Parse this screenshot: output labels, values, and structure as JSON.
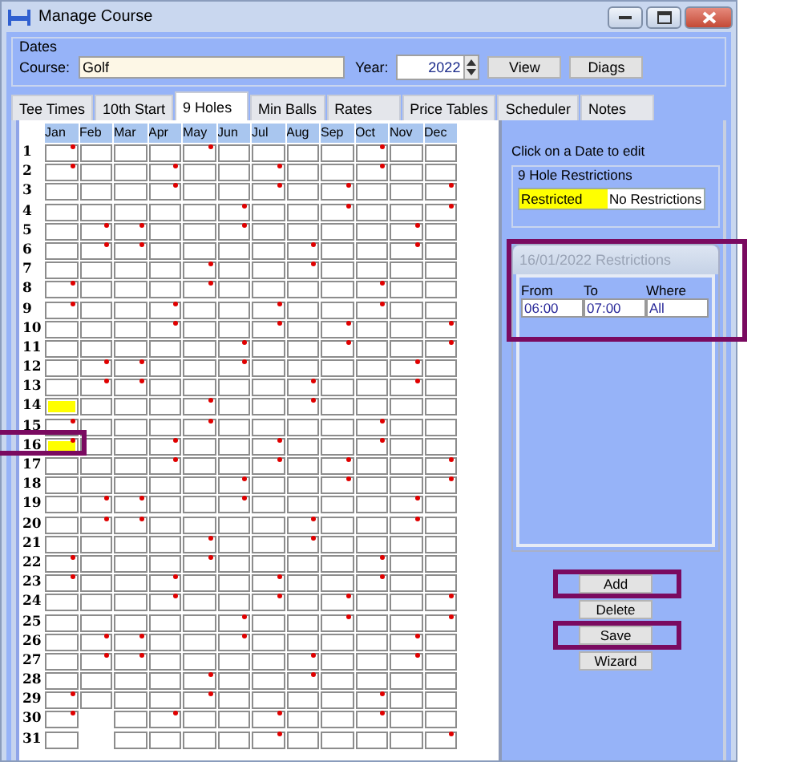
{
  "window": {
    "title": "Manage Course"
  },
  "dates": {
    "legend": "Dates",
    "course_label": "Course:",
    "course": "Golf",
    "year_label": "Year:",
    "year": "2022",
    "buttons": [
      "View",
      "Diags"
    ]
  },
  "tabs": [
    {
      "label": "Tee Times",
      "selected": false
    },
    {
      "label": "10th Start",
      "selected": false
    },
    {
      "label": "9 Holes",
      "selected": true
    },
    {
      "label": "Min Balls",
      "selected": false
    },
    {
      "label": "Rates",
      "selected": false
    },
    {
      "label": "Price Tables",
      "selected": false
    },
    {
      "label": "Scheduler",
      "selected": false
    },
    {
      "label": "Notes",
      "selected": false
    }
  ],
  "calendar": {
    "months": [
      "Jan",
      "Feb",
      "Mar",
      "Apr",
      "May",
      "Jun",
      "Jul",
      "Aug",
      "Sep",
      "Oct",
      "Nov",
      "Dec"
    ],
    "rows": [
      {
        "day": "1",
        "kind": "full",
        "dots": [
          true,
          false,
          false,
          false,
          true,
          false,
          false,
          false,
          false,
          true,
          false,
          false
        ],
        "restricted": [
          false,
          false,
          false,
          false,
          false,
          false,
          false,
          false,
          false,
          false,
          false,
          false
        ]
      },
      {
        "day": "2",
        "kind": "full",
        "dots": [
          true,
          false,
          false,
          true,
          false,
          false,
          true,
          false,
          false,
          true,
          false,
          false
        ],
        "restricted": [
          false,
          false,
          false,
          false,
          false,
          false,
          false,
          false,
          false,
          false,
          false,
          false
        ]
      },
      {
        "day": "3",
        "kind": "full",
        "dots": [
          false,
          false,
          false,
          true,
          false,
          false,
          true,
          false,
          true,
          false,
          false,
          true
        ],
        "restricted": [
          false,
          false,
          false,
          false,
          false,
          false,
          false,
          false,
          false,
          false,
          false,
          false
        ]
      },
      {
        "day": "4",
        "kind": "full",
        "dots": [
          false,
          false,
          false,
          false,
          false,
          true,
          false,
          false,
          true,
          false,
          false,
          true
        ],
        "restricted": [
          false,
          false,
          false,
          false,
          false,
          false,
          false,
          false,
          false,
          false,
          false,
          false
        ]
      },
      {
        "day": "5",
        "kind": "full",
        "dots": [
          false,
          true,
          true,
          false,
          false,
          true,
          false,
          false,
          false,
          false,
          true,
          false
        ],
        "restricted": [
          false,
          false,
          false,
          false,
          false,
          false,
          false,
          false,
          false,
          false,
          false,
          false
        ]
      },
      {
        "day": "6",
        "kind": "full",
        "dots": [
          false,
          true,
          true,
          false,
          false,
          false,
          false,
          true,
          false,
          false,
          true,
          false
        ],
        "restricted": [
          false,
          false,
          false,
          false,
          false,
          false,
          false,
          false,
          false,
          false,
          false,
          false
        ]
      },
      {
        "day": "7",
        "kind": "full",
        "dots": [
          false,
          false,
          false,
          false,
          true,
          false,
          false,
          true,
          false,
          false,
          false,
          false
        ],
        "restricted": [
          false,
          false,
          false,
          false,
          false,
          false,
          false,
          false,
          false,
          false,
          false,
          false
        ]
      },
      {
        "day": "8",
        "kind": "full",
        "dots": [
          true,
          false,
          false,
          false,
          true,
          false,
          false,
          false,
          false,
          true,
          false,
          false
        ],
        "restricted": [
          false,
          false,
          false,
          false,
          false,
          false,
          false,
          false,
          false,
          false,
          false,
          false
        ]
      },
      {
        "day": "9",
        "kind": "full",
        "dots": [
          true,
          false,
          false,
          true,
          false,
          false,
          true,
          false,
          false,
          true,
          false,
          false
        ],
        "restricted": [
          false,
          false,
          false,
          false,
          false,
          false,
          false,
          false,
          false,
          false,
          false,
          false
        ]
      },
      {
        "day": "10",
        "kind": "full",
        "dots": [
          false,
          false,
          false,
          true,
          false,
          false,
          true,
          false,
          true,
          false,
          false,
          true
        ],
        "restricted": [
          false,
          false,
          false,
          false,
          false,
          false,
          false,
          false,
          false,
          false,
          false,
          false
        ]
      },
      {
        "day": "11",
        "kind": "full",
        "dots": [
          false,
          false,
          false,
          false,
          false,
          true,
          false,
          false,
          true,
          false,
          false,
          true
        ],
        "restricted": [
          false,
          false,
          false,
          false,
          false,
          false,
          false,
          false,
          false,
          false,
          false,
          false
        ]
      },
      {
        "day": "12",
        "kind": "full",
        "dots": [
          false,
          true,
          true,
          false,
          false,
          true,
          false,
          false,
          false,
          false,
          true,
          false
        ],
        "restricted": [
          false,
          false,
          false,
          false,
          false,
          false,
          false,
          false,
          false,
          false,
          false,
          false
        ]
      },
      {
        "day": "13",
        "kind": "full",
        "dots": [
          false,
          true,
          true,
          false,
          false,
          false,
          false,
          true,
          false,
          false,
          true,
          false
        ],
        "restricted": [
          false,
          false,
          false,
          false,
          false,
          false,
          false,
          false,
          false,
          false,
          false,
          false
        ]
      },
      {
        "day": "14",
        "kind": "full",
        "dots": [
          false,
          false,
          false,
          false,
          true,
          false,
          false,
          true,
          false,
          false,
          false,
          false
        ],
        "restricted": [
          true,
          false,
          false,
          false,
          false,
          false,
          false,
          false,
          false,
          false,
          false,
          false
        ]
      },
      {
        "day": "15",
        "kind": "full",
        "dots": [
          true,
          false,
          false,
          false,
          true,
          false,
          false,
          false,
          false,
          true,
          false,
          false
        ],
        "restricted": [
          false,
          false,
          false,
          false,
          false,
          false,
          false,
          false,
          false,
          false,
          false,
          false
        ]
      },
      {
        "day": "16",
        "kind": "full",
        "highlighted": true,
        "dots": [
          true,
          false,
          false,
          true,
          false,
          false,
          true,
          false,
          false,
          true,
          false,
          false
        ],
        "restricted": [
          true,
          false,
          false,
          false,
          false,
          false,
          false,
          false,
          false,
          false,
          false,
          false
        ]
      },
      {
        "day": "17",
        "kind": "full",
        "dots": [
          false,
          false,
          false,
          true,
          false,
          false,
          true,
          false,
          true,
          false,
          false,
          true
        ],
        "restricted": [
          false,
          false,
          false,
          false,
          false,
          false,
          false,
          false,
          false,
          false,
          false,
          false
        ]
      },
      {
        "day": "18",
        "kind": "full",
        "dots": [
          false,
          false,
          false,
          false,
          false,
          true,
          false,
          false,
          true,
          false,
          false,
          true
        ],
        "restricted": [
          false,
          false,
          false,
          false,
          false,
          false,
          false,
          false,
          false,
          false,
          false,
          false
        ]
      },
      {
        "day": "19",
        "kind": "full",
        "dots": [
          false,
          true,
          true,
          false,
          false,
          true,
          false,
          false,
          false,
          false,
          true,
          false
        ],
        "restricted": [
          false,
          false,
          false,
          false,
          false,
          false,
          false,
          false,
          false,
          false,
          false,
          false
        ]
      },
      {
        "day": "20",
        "kind": "full",
        "dots": [
          false,
          true,
          true,
          false,
          false,
          false,
          false,
          true,
          false,
          false,
          true,
          false
        ],
        "restricted": [
          false,
          false,
          false,
          false,
          false,
          false,
          false,
          false,
          false,
          false,
          false,
          false
        ]
      },
      {
        "day": "21",
        "kind": "full",
        "dots": [
          false,
          false,
          false,
          false,
          true,
          false,
          false,
          true,
          false,
          false,
          false,
          false
        ],
        "restricted": [
          false,
          false,
          false,
          false,
          false,
          false,
          false,
          false,
          false,
          false,
          false,
          false
        ]
      },
      {
        "day": "22",
        "kind": "full",
        "dots": [
          true,
          false,
          false,
          false,
          true,
          false,
          false,
          false,
          false,
          true,
          false,
          false
        ],
        "restricted": [
          false,
          false,
          false,
          false,
          false,
          false,
          false,
          false,
          false,
          false,
          false,
          false
        ]
      },
      {
        "day": "23",
        "kind": "full",
        "dots": [
          true,
          false,
          false,
          true,
          false,
          false,
          true,
          false,
          false,
          true,
          false,
          false
        ],
        "restricted": [
          false,
          false,
          false,
          false,
          false,
          false,
          false,
          false,
          false,
          false,
          false,
          false
        ]
      },
      {
        "day": "24",
        "kind": "full",
        "dots": [
          false,
          false,
          false,
          true,
          false,
          false,
          true,
          false,
          true,
          false,
          false,
          true
        ],
        "restricted": [
          false,
          false,
          false,
          false,
          false,
          false,
          false,
          false,
          false,
          false,
          false,
          false
        ]
      },
      {
        "day": "25",
        "kind": "full",
        "dots": [
          false,
          false,
          false,
          false,
          false,
          true,
          false,
          false,
          true,
          false,
          false,
          true
        ],
        "restricted": [
          false,
          false,
          false,
          false,
          false,
          false,
          false,
          false,
          false,
          false,
          false,
          false
        ]
      },
      {
        "day": "26",
        "kind": "full",
        "dots": [
          false,
          true,
          true,
          false,
          false,
          true,
          false,
          false,
          false,
          false,
          true,
          false
        ],
        "restricted": [
          false,
          false,
          false,
          false,
          false,
          false,
          false,
          false,
          false,
          false,
          false,
          false
        ]
      },
      {
        "day": "27",
        "kind": "full",
        "dots": [
          false,
          true,
          true,
          false,
          false,
          false,
          false,
          true,
          false,
          false,
          true,
          false
        ],
        "restricted": [
          false,
          false,
          false,
          false,
          false,
          false,
          false,
          false,
          false,
          false,
          false,
          false
        ]
      },
      {
        "day": "28",
        "kind": "full",
        "dots": [
          false,
          false,
          false,
          false,
          true,
          false,
          false,
          true,
          false,
          false,
          false,
          false
        ],
        "restricted": [
          false,
          false,
          false,
          false,
          false,
          false,
          false,
          false,
          false,
          false,
          false,
          false
        ]
      },
      {
        "day": "29",
        "kind": "full",
        "dots": [
          true,
          false,
          false,
          false,
          true,
          false,
          false,
          false,
          false,
          true,
          false,
          false
        ],
        "restricted": [
          false,
          false,
          false,
          false,
          false,
          false,
          false,
          false,
          false,
          false,
          false,
          false
        ]
      },
      {
        "day": "30",
        "kind": "no_feb",
        "dots": [
          true,
          false,
          true,
          false,
          false,
          true,
          false,
          false,
          true,
          false,
          false
        ],
        "restricted": [
          false,
          false,
          false,
          false,
          false,
          false,
          false,
          false,
          false,
          false,
          false
        ]
      },
      {
        "day": "31",
        "kind": "no_feb",
        "dots": [
          false,
          false,
          false,
          false,
          false,
          true,
          false,
          false,
          false,
          false,
          true
        ],
        "restricted": [
          false,
          false,
          false,
          false,
          false,
          false,
          false,
          false,
          false,
          false,
          false
        ]
      }
    ]
  },
  "side": {
    "hint": "Click on a Date to edit",
    "legend_title": "9 Hole Restrictions",
    "legend_items": [
      {
        "label": "Restricted",
        "color": "#ffff00"
      },
      {
        "label": "No Restrictions",
        "color": "#ffffff"
      }
    ],
    "restrictions": {
      "title": "16/01/2022 Restrictions",
      "highlighted": true,
      "columns": [
        "From",
        "To",
        "Where"
      ],
      "row": [
        "06:00",
        "07:00",
        "All"
      ]
    },
    "buttons": [
      {
        "label": "Add",
        "highlighted": true
      },
      {
        "label": "Delete",
        "highlighted": false
      },
      {
        "label": "Save",
        "highlighted": true
      },
      {
        "label": "Wizard",
        "highlighted": false
      }
    ]
  }
}
